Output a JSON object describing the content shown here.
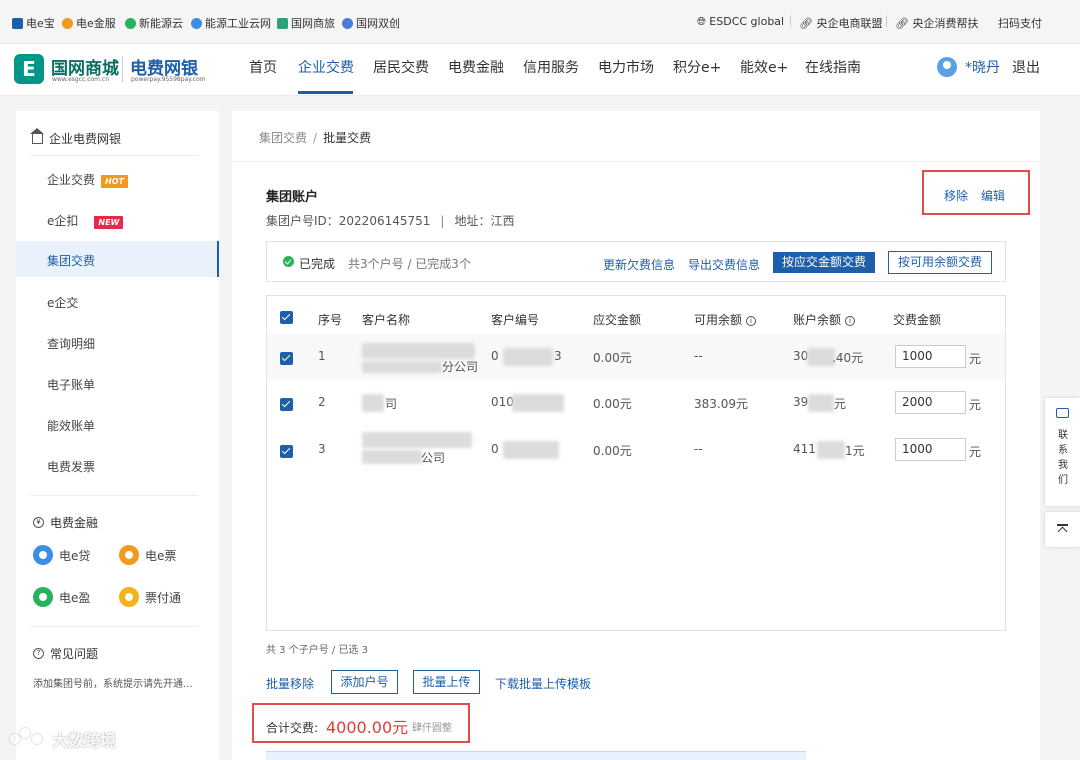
{
  "topbar": {
    "links": [
      {
        "label": "电e宝",
        "color": "#1d5fa8"
      },
      {
        "label": "电e金服",
        "color": "#f39a1e"
      },
      {
        "label": "新能源云",
        "color": "#27b35b"
      },
      {
        "label": "能源工业云网",
        "color": "#3a8ee6"
      },
      {
        "label": "国网商旅",
        "color": "#2aa37a"
      },
      {
        "label": "国网双创",
        "color": "#4b7bd6"
      }
    ],
    "right_links": [
      "ESDCC global",
      "央企电商联盟",
      "央企消费帮扶"
    ],
    "scan_pay": "扫码支付"
  },
  "header": {
    "logo_mark": "E",
    "logo_text1": "国网商城",
    "logo_sub1": "www.esgcc.com.cn",
    "logo_text2": "电费网银",
    "logo_sub2": "powerpay.95598pay.com",
    "nav": [
      "首页",
      "企业交费",
      "居民交费",
      "电费金融",
      "信用服务",
      "电力市场",
      "积分e+",
      "能效e+",
      "在线指南"
    ],
    "active_nav": "企业交费",
    "user": "*晓丹",
    "logout": "退出"
  },
  "sidebar": {
    "title": "企业电费网银",
    "items": [
      {
        "label": "企业交费",
        "badge": "HOT"
      },
      {
        "label": "e企扣",
        "badge": "NEW"
      },
      {
        "label": "集团交费",
        "badge": ""
      },
      {
        "label": "e企交",
        "badge": ""
      },
      {
        "label": "查询明细",
        "badge": ""
      },
      {
        "label": "电子账单",
        "badge": ""
      },
      {
        "label": "能效账单",
        "badge": ""
      },
      {
        "label": "电费发票",
        "badge": ""
      }
    ],
    "active_item": "集团交费",
    "finance_title": "电费金融",
    "finance_items": [
      {
        "label": "电e贷",
        "color": "#3a8ee6"
      },
      {
        "label": "电e票",
        "color": "#f39a1e"
      },
      {
        "label": "电e盈",
        "color": "#27b35b"
      },
      {
        "label": "票付通",
        "color": "#f5b21b"
      }
    ],
    "faq_title": "常见问题",
    "faq_text": "添加集团号前，系统提示请先开通..."
  },
  "main": {
    "breadcrumb": [
      "集团交费",
      "批量交费"
    ],
    "account_title": "集团账户",
    "account_id_label": "集团户号ID：202206145751",
    "address_label": "地址：江西",
    "remove": "移除",
    "edit": "编辑",
    "status": {
      "done": "已完成",
      "count": "共3个户号 / 已完成3个",
      "refresh_link": "更新欠费信息",
      "export_link": "导出交费信息",
      "pay_due_button": "按应交金额交费",
      "pay_balance_button": "按可用余额交费"
    },
    "table": {
      "headers": [
        "序号",
        "客户名称",
        "客户编号",
        "应交金额",
        "可用余额",
        "账户余额",
        "交费金额"
      ],
      "rows": [
        {
          "index": "1",
          "name_visible": "分公司",
          "id_visible": "0",
          "id_tail": "3",
          "due": "0.00元",
          "available": "--",
          "balance_head": "30",
          "balance_tail": ".40元",
          "amount": "1000",
          "unit": "元",
          "checked": true
        },
        {
          "index": "2",
          "name_visible": "司",
          "id_visible": "010",
          "id_tail": "",
          "due": "0.00元",
          "available": "383.09元",
          "balance_head": "39",
          "balance_tail": "元",
          "amount": "2000",
          "unit": "元",
          "checked": true
        },
        {
          "index": "3",
          "name_visible": "公司",
          "id_visible": "0",
          "id_tail": "",
          "due": "0.00元",
          "available": "--",
          "balance_head": "411",
          "balance_tail": "1元",
          "amount": "1000",
          "unit": "元",
          "checked": true
        }
      ]
    },
    "footer": {
      "count": "共 3 个子户号 / 已选 3",
      "batch_remove": "批量移除",
      "add_account": "添加户号",
      "batch_upload": "批量上传",
      "download_template": "下载批量上传模板",
      "total_label": "合计交费:",
      "total_value": "4000.00元",
      "total_words": "肆仟圆整"
    }
  },
  "float": {
    "contact": "联系我们"
  },
  "watermark": "大数跨境"
}
